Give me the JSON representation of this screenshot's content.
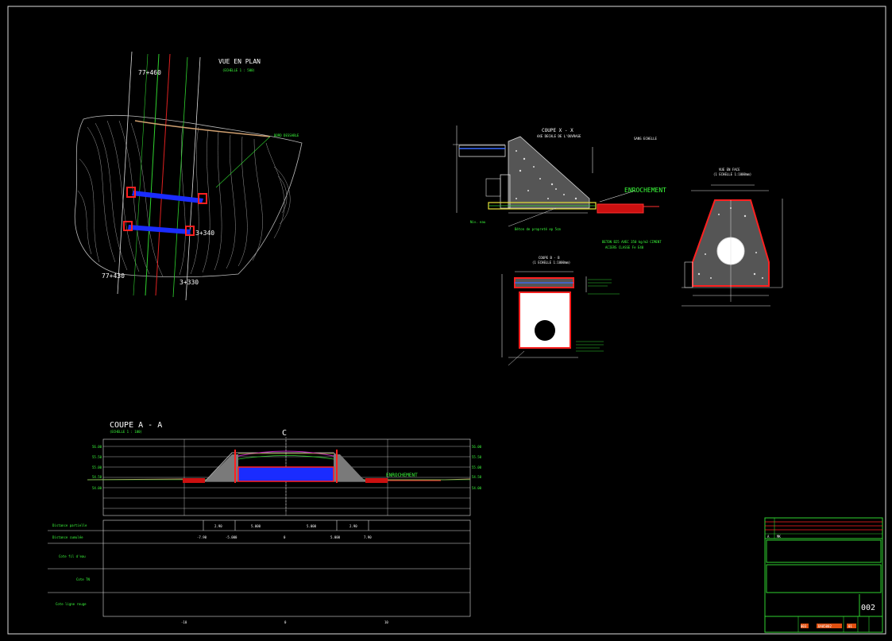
{
  "plan_view": {
    "title": "VUE EN PLAN",
    "scale": "(ECHELLE 1 : 500)",
    "station_top": "77+460",
    "station_bottom": "77+430",
    "station_mid": "3+340",
    "station_right_bottom": "3+330"
  },
  "section_x": {
    "title": "COUPE X - X",
    "subtitle": "AXE DECALE DE L'OUVRAGE",
    "note_no_scale": "SANS ECHELLE",
    "label_enrochement": "ENROCHEMENT",
    "concrete_note_line1": "BETON B25 AVEC 350 kg/m3 CIMENT",
    "concrete_note_line2": "ACIERS CLASSE Fe E40"
  },
  "front_view": {
    "title": "VUE EN FACE",
    "scale": "(1 ECHELLE 1:1000mm)"
  },
  "section_b": {
    "title": "COUPE B - B",
    "scale": "(1 ECHELLE 1:1000mm)"
  },
  "profile": {
    "title": "COUPE A - A",
    "scale": "(ECHELLE 1 : 100)",
    "axis_marker": "C",
    "label_enrochement": "ENROCHEMENT",
    "row_labels": [
      "Distance partielle",
      "Distance cumulée",
      "Cote fil d'eau",
      "Cote TN",
      "Cote ligne rouge"
    ],
    "partial_distances": [
      "2.90",
      "5.000",
      "5.000",
      "2.90"
    ],
    "cumulative_distances": [
      "-7.90",
      "-5.000",
      "0",
      "5.000",
      "7.90"
    ],
    "axis_ticks": [
      "-10",
      "0",
      "10"
    ]
  },
  "title_block": {
    "rev": "A",
    "mark": "MK",
    "sheet_code": "002",
    "project_code": "003",
    "drawing_no": "DA05002",
    "sheet_no": "01"
  }
}
